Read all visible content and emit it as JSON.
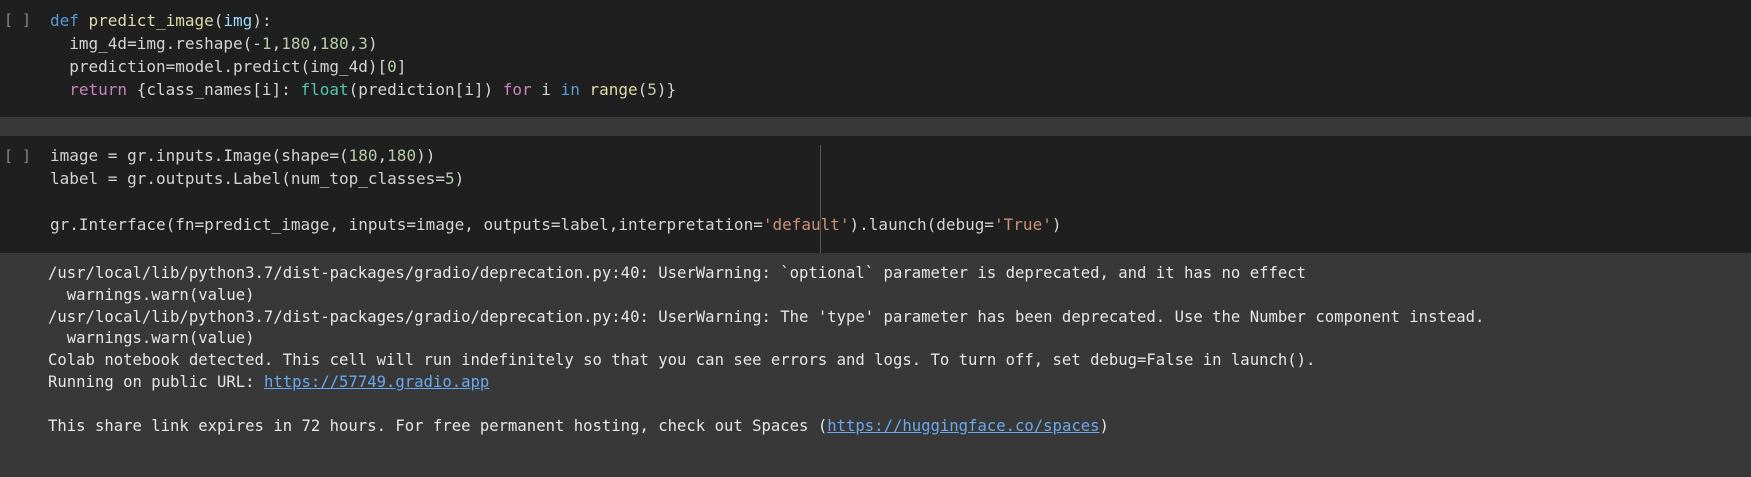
{
  "cells": [
    {
      "run_button": "[ ]",
      "lines": [
        [
          {
            "t": "def ",
            "c": "kw"
          },
          {
            "t": "predict_image",
            "c": "fn"
          },
          {
            "t": "(",
            "c": "plain"
          },
          {
            "t": "img",
            "c": "var"
          },
          {
            "t": "):",
            "c": "plain"
          }
        ],
        [
          {
            "t": "  img_4d=img.reshape(-",
            "c": "plain"
          },
          {
            "t": "1",
            "c": "num"
          },
          {
            "t": ",",
            "c": "plain"
          },
          {
            "t": "180",
            "c": "num"
          },
          {
            "t": ",",
            "c": "plain"
          },
          {
            "t": "180",
            "c": "num"
          },
          {
            "t": ",",
            "c": "plain"
          },
          {
            "t": "3",
            "c": "num"
          },
          {
            "t": ")",
            "c": "plain"
          }
        ],
        [
          {
            "t": "  prediction=model.predict(img_4d)[",
            "c": "plain"
          },
          {
            "t": "0",
            "c": "num"
          },
          {
            "t": "]",
            "c": "plain"
          }
        ],
        [
          {
            "t": "  ",
            "c": "plain"
          },
          {
            "t": "return",
            "c": "ctrl"
          },
          {
            "t": " {class_names[i]: ",
            "c": "plain"
          },
          {
            "t": "float",
            "c": "blt"
          },
          {
            "t": "(prediction[i]) ",
            "c": "plain"
          },
          {
            "t": "for",
            "c": "ctrl"
          },
          {
            "t": " i ",
            "c": "plain"
          },
          {
            "t": "in",
            "c": "kw"
          },
          {
            "t": " ",
            "c": "plain"
          },
          {
            "t": "range",
            "c": "fn"
          },
          {
            "t": "(",
            "c": "plain"
          },
          {
            "t": "5",
            "c": "num"
          },
          {
            "t": ")}",
            "c": "plain"
          }
        ]
      ]
    },
    {
      "run_button": "[ ]",
      "lines": [
        [
          {
            "t": "image = gr.inputs.Image(shape=(",
            "c": "plain"
          },
          {
            "t": "180",
            "c": "num"
          },
          {
            "t": ",",
            "c": "plain"
          },
          {
            "t": "180",
            "c": "num"
          },
          {
            "t": "))",
            "c": "plain"
          }
        ],
        [
          {
            "t": "label = gr.outputs.Label(num_top_classes=",
            "c": "plain"
          },
          {
            "t": "5",
            "c": "num"
          },
          {
            "t": ")",
            "c": "plain"
          }
        ],
        [
          {
            "t": "",
            "c": "plain"
          }
        ],
        [
          {
            "t": "gr.Interface(fn=predict_image, inputs=image, outputs=label,interpretation=",
            "c": "plain"
          },
          {
            "t": "'default'",
            "c": "str"
          },
          {
            "t": ").launch(debug=",
            "c": "plain"
          },
          {
            "t": "'True'",
            "c": "str"
          },
          {
            "t": ")",
            "c": "plain"
          }
        ]
      ],
      "output": [
        {
          "text": "/usr/local/lib/python3.7/dist-packages/gradio/deprecation.py:40: UserWarning: `optional` parameter is deprecated, and it has no effect"
        },
        {
          "text": "  warnings.warn(value)"
        },
        {
          "text": "/usr/local/lib/python3.7/dist-packages/gradio/deprecation.py:40: UserWarning: The 'type' parameter has been deprecated. Use the Number component instead."
        },
        {
          "text": "  warnings.warn(value)"
        },
        {
          "text": "Colab notebook detected. This cell will run indefinitely so that you can see errors and logs. To turn off, set debug=False in launch()."
        },
        {
          "prefix": "Running on public URL: ",
          "link": "https://57749.gradio.app",
          "suffix": ""
        },
        {
          "text": ""
        },
        {
          "prefix": "This share link expires in 72 hours. For free permanent hosting, check out Spaces (",
          "link": "https://huggingface.co/spaces",
          "suffix": ")"
        }
      ]
    }
  ],
  "colors": {
    "keyword": "#569cd6",
    "function": "#dcdcaa",
    "number": "#b5cea8",
    "control": "#c586c0",
    "builtin": "#4ec9b0",
    "string": "#ce9178",
    "variable": "#9cdcfe",
    "link": "#6aa9f0"
  }
}
